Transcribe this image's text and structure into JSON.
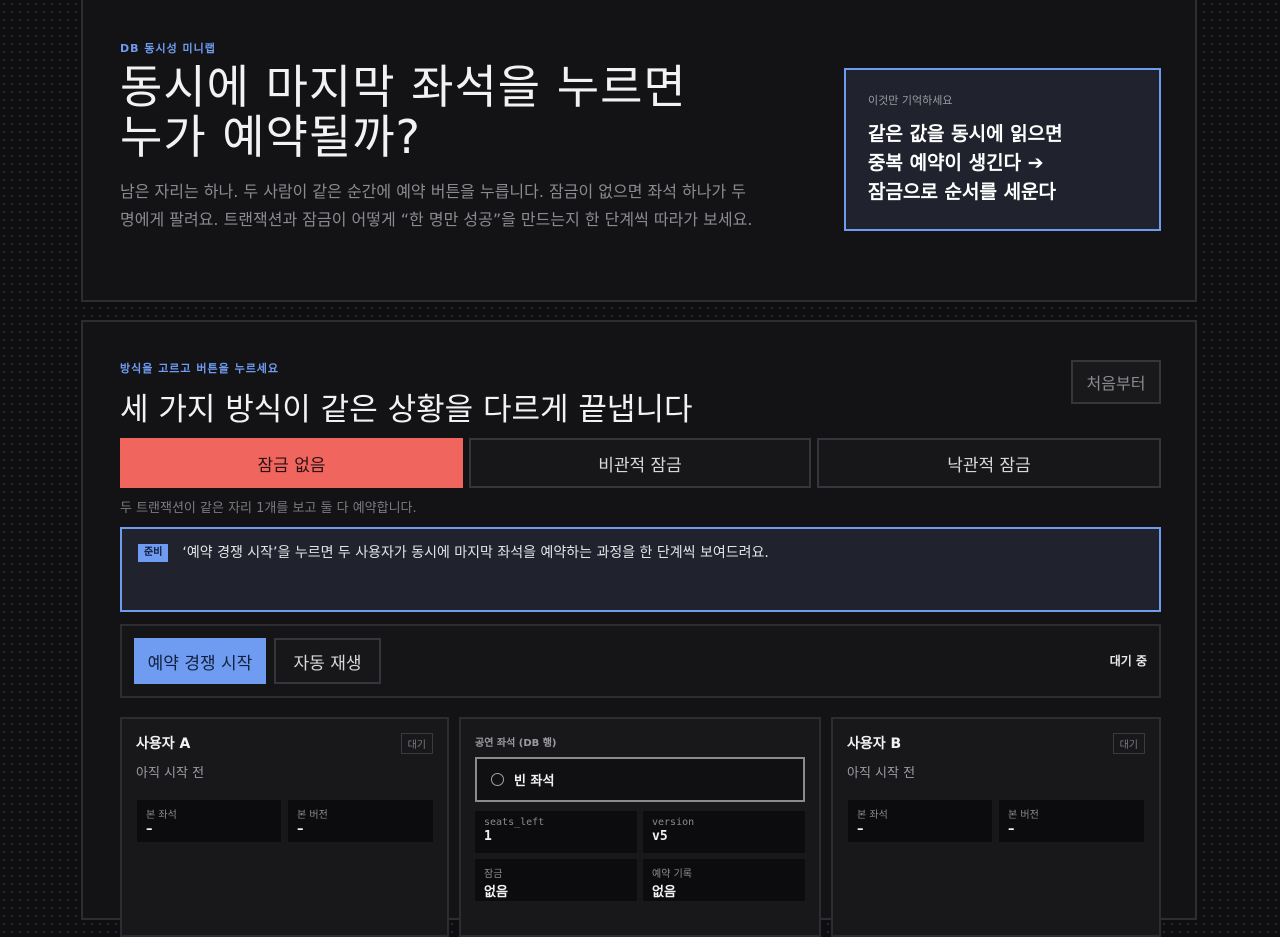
{
  "hero": {
    "eyebrow": "DB 동시성 미니랩",
    "title_line1": "동시에 마지막 좌석을 누르면",
    "title_line2": "누가 예약될까?",
    "description": "남은 자리는 하나. 두 사람이 같은 순간에 예약 버튼을 누릅니다. 잠금이 없으면 좌석 하나가 두 명에게 팔려요. 트랜잭션과 잠금이 어떻게 “한 명만 성공”을 만드는지 한 단계씩 따라가 보세요.",
    "memo": {
      "label": "이것만 기억하세요",
      "line1": "같은 값을 동시에 읽으면",
      "line2": "중복 예약이 생긴다 ➔",
      "line3": "잠금으로 순서를 세운다"
    }
  },
  "sim": {
    "eyebrow": "방식을 고르고 버튼을 누르세요",
    "title": "세 가지 방식이 같은 상황을 다르게 끝냅니다",
    "reset_label": "처음부터",
    "modes": [
      "잠금 없음",
      "비관적 잠금",
      "낙관적 잠금"
    ],
    "active_mode": 0,
    "mode_desc": "두 트랜잭션이 같은 자리 1개를 보고 둘 다 예약합니다.",
    "notice": {
      "badge": "준비",
      "text": "‘예약 경쟁 시작’을 누르면 두 사용자가 동시에 마지막 좌석을 예약하는 과정을 한 단계씩 보여드려요."
    },
    "controls": {
      "start_label": "예약 경쟁 시작",
      "autoplay_label": "자동 재생",
      "status": "대기 중"
    },
    "user_a": {
      "name": "사용자 A",
      "state": "대기",
      "sub": "아직 시작 전",
      "seen_seat_label": "본 좌석",
      "seen_seat_value": "–",
      "seen_version_label": "본 버전",
      "seen_version_value": "–"
    },
    "seat": {
      "label": "공연 좌석 (DB 행)",
      "status": "빈 좌석",
      "seats_left_label": "seats_left",
      "seats_left_value": "1",
      "version_label": "version",
      "version_value": "v5",
      "lock_label": "잠금",
      "lock_value": "없음",
      "record_label": "예약 기록",
      "record_value": "없음"
    },
    "user_b": {
      "name": "사용자 B",
      "state": "대기",
      "sub": "아직 시작 전",
      "seen_seat_label": "본 좌석",
      "seen_seat_value": "–",
      "seen_version_label": "본 버전",
      "seen_version_value": "–"
    }
  },
  "colors": {
    "accent_blue": "#6f9bf0",
    "accent_red": "#f0665f",
    "background": "#0e0e10",
    "card": "#131316"
  }
}
